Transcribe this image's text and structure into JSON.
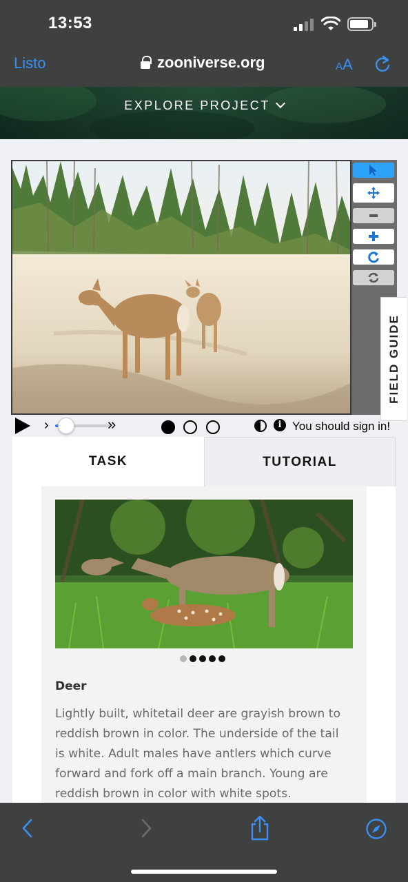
{
  "status_bar": {
    "time": "13:53"
  },
  "browser": {
    "done_label": "Listo",
    "url": "zooniverse.org",
    "text_size_small": "A",
    "text_size_large": "A",
    "accent_color": "#3b8ff4"
  },
  "project": {
    "explore_label": "EXPLORE PROJECT"
  },
  "viewer": {
    "tools": [
      "pointer-icon",
      "move-icon",
      "zoom-out-icon",
      "zoom-in-icon",
      "rotate-icon",
      "reset-icon"
    ],
    "field_guide_label": "FIELD GUIDE",
    "frames": {
      "count": 3,
      "current": 1
    },
    "playback_progress": 0.1,
    "sign_in_message": "You should sign in!"
  },
  "tabs": {
    "task": "TASK",
    "tutorial": "TUTORIAL",
    "active": "TASK"
  },
  "field_guide_item": {
    "pages": 5,
    "current_page": 1,
    "name": "Deer",
    "description": "Lightly built, whitetail deer are grayish brown to reddish brown in color. The underside of the tail is white. Adult males have antlers which curve forward and fork off a main branch. Young are reddish brown in color with white spots."
  },
  "nav": {
    "back": "back-icon",
    "forward": "forward-icon",
    "share": "share-icon",
    "compass": "compass-icon"
  }
}
